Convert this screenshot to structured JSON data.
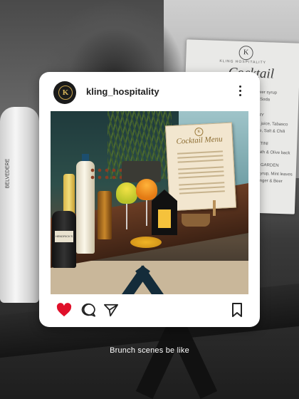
{
  "post": {
    "username": "kling_hospitality",
    "avatar_letter": "K",
    "liked": true
  },
  "photo": {
    "menu_logo": "K",
    "menu_title": "Cocktail Menu",
    "bottle_label": "HENDRICK'S"
  },
  "background": {
    "menu_logo": "K",
    "menu_brand": "KLING HOSPITALITY",
    "menu_title": "Cocktail Menu",
    "menu_lines": [
      "ower syrup",
      "& Soda",
      "ARY",
      "ne juice, Tabasco",
      "uce, Salt & Chili",
      "ARTINI",
      "rmath & Olive back",
      "RY GARDEN",
      "ry syrup, Mint leaves",
      ", Ginger & Beer"
    ],
    "bottle_label": "BELVEDERE"
  },
  "caption": "Brunch scenes be like",
  "colors": {
    "heart": "#e0102a",
    "card": "#ffffff",
    "avatar_bg": "#1b1b1b",
    "avatar_gold": "#c9a44a"
  },
  "icons": [
    "heart-icon",
    "comment-icon",
    "share-icon",
    "bookmark-icon",
    "more-options-icon"
  ]
}
